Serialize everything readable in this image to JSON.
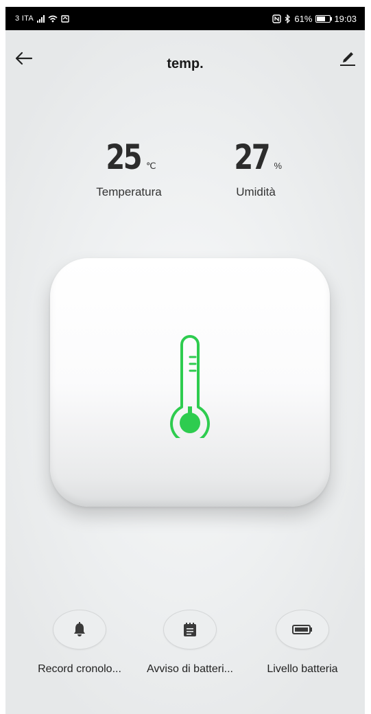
{
  "status_bar": {
    "carrier": "3 ITA",
    "battery_percent": "61%",
    "time": "19:03"
  },
  "header": {
    "title": "temp."
  },
  "readings": {
    "temperature": {
      "value": "25",
      "unit": "℃",
      "label": "Temperatura"
    },
    "humidity": {
      "value": "27",
      "unit": "%",
      "label": "Umidità"
    }
  },
  "actions": [
    {
      "label": "Record cronolo...",
      "icon": "bell-icon"
    },
    {
      "label": "Avviso di batteri...",
      "icon": "notepad-icon"
    },
    {
      "label": "Livello batteria",
      "icon": "battery-icon"
    }
  ],
  "colors": {
    "thermometer": "#2ecc4f",
    "status_bar": "#000000"
  }
}
